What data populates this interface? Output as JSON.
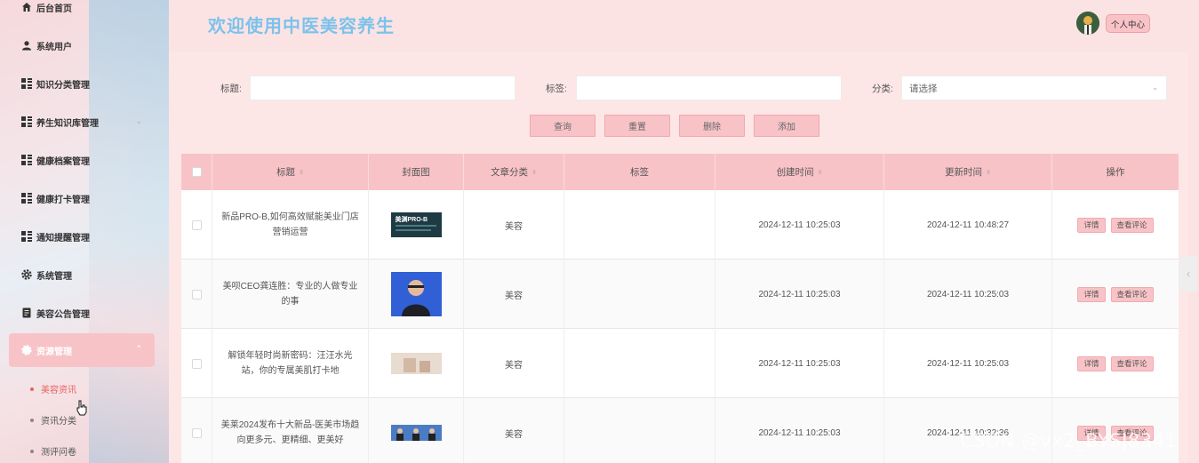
{
  "sidebar": {
    "items": [
      {
        "label": "后台首页",
        "icon": "home-icon"
      },
      {
        "label": "系统用户",
        "icon": "user-icon"
      },
      {
        "label": "知识分类管理",
        "icon": "grid-icon"
      },
      {
        "label": "养生知识库管理",
        "icon": "grid-icon"
      },
      {
        "label": "健康档案管理",
        "icon": "grid-icon"
      },
      {
        "label": "健康打卡管理",
        "icon": "grid-icon"
      },
      {
        "label": "通知提醒管理",
        "icon": "grid-icon"
      },
      {
        "label": "系统管理",
        "icon": "gear-icon"
      },
      {
        "label": "美容公告管理",
        "icon": "document-icon"
      },
      {
        "label": "资源管理",
        "icon": "resource-icon"
      }
    ],
    "subitems": [
      {
        "label": "美容资讯"
      },
      {
        "label": "资讯分类"
      },
      {
        "label": "测评问卷"
      }
    ]
  },
  "header": {
    "welcome": "欢迎使用中医美容养生",
    "personal_center": "个人中心"
  },
  "filters": {
    "title_label": "标题:",
    "tag_label": "标签:",
    "category_label": "分类:",
    "category_placeholder": "请选择"
  },
  "actions": {
    "query": "查询",
    "reset": "重置",
    "delete": "删除",
    "add": "添加"
  },
  "table": {
    "headers": {
      "title": "标题",
      "cover": "封面图",
      "category": "文章分类",
      "tag": "标签",
      "created": "创建时间",
      "updated": "更新时间",
      "ops": "操作"
    },
    "detail_label": "详情",
    "comment_label": "查看评论",
    "rows": [
      {
        "title": "新品PRO-B,如何高效赋能美业门店营销运营",
        "category": "美容",
        "tag": "",
        "created": "2024-12-11 10:25:03",
        "updated": "2024-12-11 10:48:27"
      },
      {
        "title": "美呗CEO龚连胜：专业的人做专业的事",
        "category": "美容",
        "tag": "",
        "created": "2024-12-11 10:25:03",
        "updated": "2024-12-11 10:25:03"
      },
      {
        "title": "解锁年轻时尚新密码：汪汪水光站，你的专属美肌打卡地",
        "category": "美容",
        "tag": "",
        "created": "2024-12-11 10:25:03",
        "updated": "2024-12-11 10:25:03"
      },
      {
        "title": "美莱2024发布十大新品-医美市场趋向更多元、更精细、更美好",
        "category": "美容",
        "tag": "",
        "created": "2024-12-11 10:25:03",
        "updated": "2024-12-11 10:32:36"
      }
    ],
    "thumb1_text": "美渊PRO-B"
  },
  "watermark": "CSDN @vx2_BYSJ8341"
}
